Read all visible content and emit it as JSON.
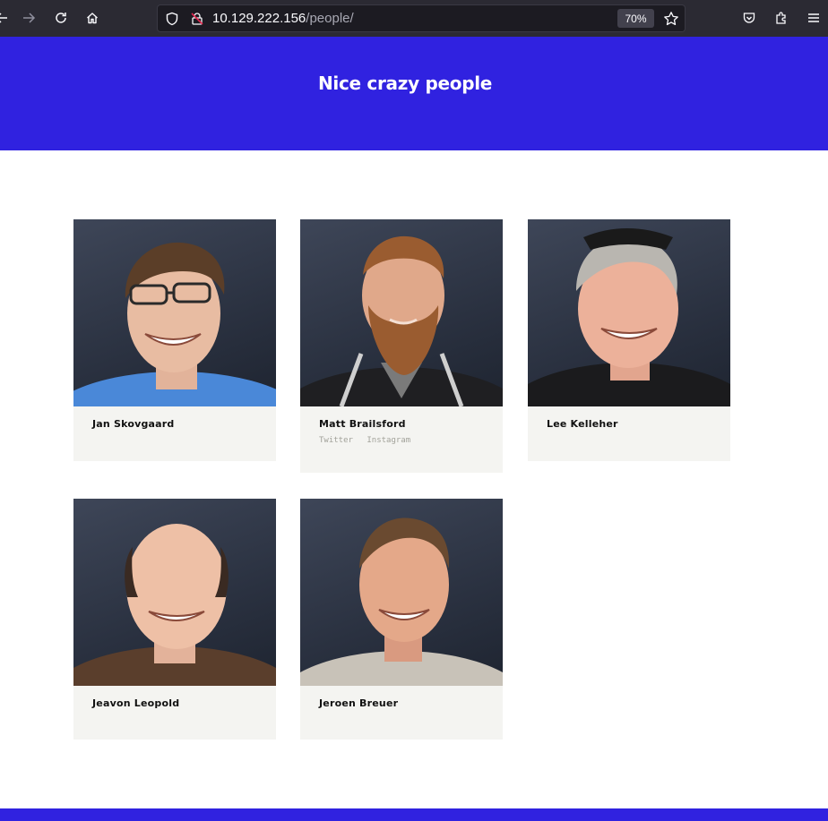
{
  "browser": {
    "url_host": "10.129.222.156",
    "url_path": "/people/",
    "zoom": "70%"
  },
  "hero": {
    "title": "Nice crazy people"
  },
  "people": [
    {
      "name": "Jan Skovgaard",
      "shirt": "#4a88d8",
      "hair": "#5b3e28",
      "glasses": true
    },
    {
      "name": "Matt Brailsford",
      "shirt": "#1f1f22",
      "hair": "#9a5c30",
      "beard": true,
      "links": [
        "Twitter",
        "Instagram"
      ]
    },
    {
      "name": "Lee Kelleher",
      "shirt": "#1b1b1d",
      "hair": "#b9b6b0"
    },
    {
      "name": "Jeavon Leopold",
      "shirt": "#5a3e2c",
      "hair": "#3a2a22"
    },
    {
      "name": "Jeroen Breuer",
      "shirt": "#c8c2b8",
      "hair": "#6a4a30"
    }
  ]
}
